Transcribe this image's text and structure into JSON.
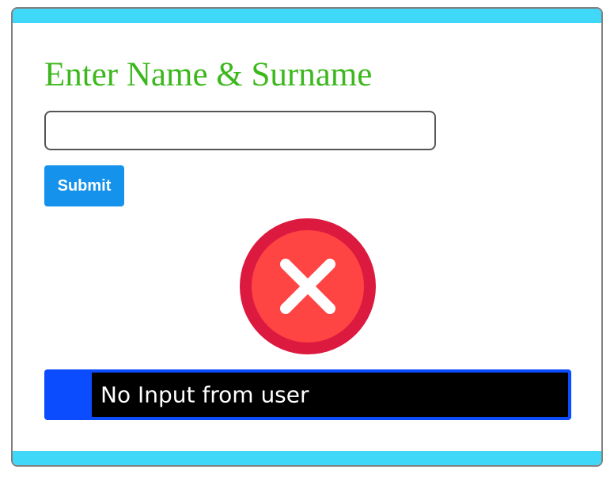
{
  "form": {
    "heading": "Enter Name & Surname",
    "name_input_value": "",
    "name_input_placeholder": "",
    "submit_label": "Submit"
  },
  "status": {
    "icon": "error-x-icon",
    "message": "No Input from user"
  },
  "colors": {
    "accent_bar": "#3fd8f8",
    "heading": "#3cb81d",
    "submit_button": "#1592ec",
    "error_ring": "#dc1a3f",
    "error_fill": "#ff4444",
    "message_accent": "#0c4cff",
    "message_background": "#000000"
  }
}
